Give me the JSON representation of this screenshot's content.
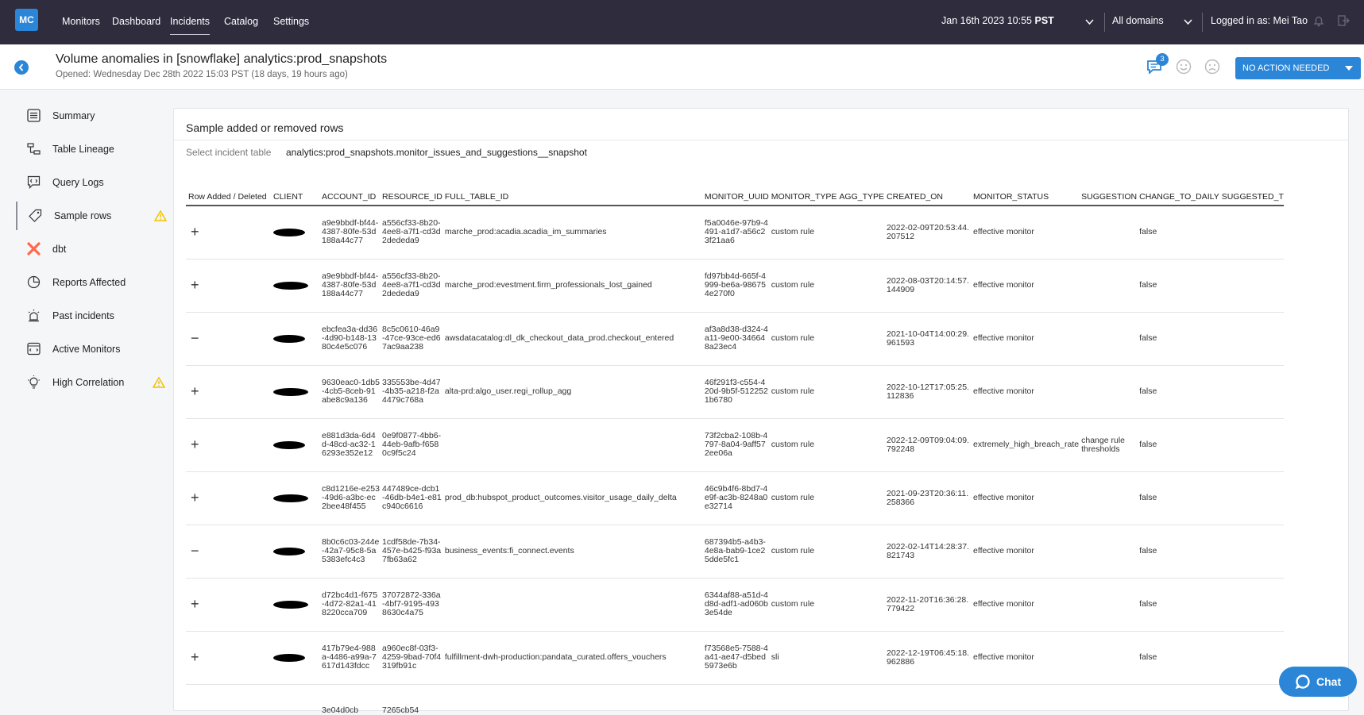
{
  "topbar": {
    "logo": "MC",
    "nav": [
      "Monitors",
      "Dashboard",
      "Incidents",
      "Catalog",
      "Settings"
    ],
    "active_nav": "Incidents",
    "datetime_main": "Jan 16th 2023 10:55",
    "datetime_tz": "PST",
    "domains": "All domains",
    "logged_in": "Logged in as: Mei Tao"
  },
  "header": {
    "title": "Volume anomalies in [snowflake] analytics:prod_snapshots",
    "subtitle": "Opened: Wednesday Dec 28th 2022 15:03 PST (18 days, 19 hours ago)",
    "comments_count": "3",
    "action_label": "NO ACTION NEEDED"
  },
  "sidebar": {
    "items": [
      {
        "label": "Summary",
        "icon": "list-icon"
      },
      {
        "label": "Table Lineage",
        "icon": "lineage-icon"
      },
      {
        "label": "Query Logs",
        "icon": "query-icon"
      },
      {
        "label": "Sample rows",
        "icon": "tag-icon",
        "active": true,
        "warning": true
      },
      {
        "label": "dbt",
        "icon": "dbt-icon"
      },
      {
        "label": "Reports Affected",
        "icon": "pie-icon"
      },
      {
        "label": "Past incidents",
        "icon": "alarm-icon"
      },
      {
        "label": "Active Monitors",
        "icon": "monitor-icon"
      },
      {
        "label": "High Correlation",
        "icon": "bulb-icon",
        "warning": true
      }
    ]
  },
  "panel": {
    "title": "Sample added or removed rows",
    "select_label": "Select incident table",
    "select_value": "analytics:prod_snapshots.monitor_issues_and_suggestions__snapshot"
  },
  "table": {
    "columns": [
      "Row Added / Deleted",
      "CLIENT",
      "ACCOUNT_ID",
      "RESOURCE_ID",
      "FULL_TABLE_ID",
      "MONITOR_UUID",
      "MONITOR_TYPE",
      "AGG_TYPE",
      "CREATED_ON",
      "MONITOR_STATUS",
      "SUGGESTION",
      "CHANGE_TO_DAILY",
      "SUGGESTED_T"
    ],
    "rows": [
      {
        "sign": "+",
        "account_id": "a9e9bbdf-bf44-4387-80fe-53d188a44c77",
        "resource_id": "a556cf33-8b20-4ee8-a7f1-cd3d2dededa9",
        "full_table_id": "marche_prod:acadia.acadia_im_summaries",
        "monitor_uuid": "f5a0046e-97b9-4491-a1d7-a56c23f21aa6",
        "monitor_type": "custom rule",
        "agg_type": "",
        "created_on": "2022-02-09T20:53:44.207512",
        "monitor_status": "effective monitor",
        "suggestion": "",
        "change_to_daily": "false",
        "suggested_t": ""
      },
      {
        "sign": "+",
        "account_id": "a9e9bbdf-bf44-4387-80fe-53d188a44c77",
        "resource_id": "a556cf33-8b20-4ee8-a7f1-cd3d2dededa9",
        "full_table_id": "marche_prod:evestment.firm_professionals_lost_gained",
        "monitor_uuid": "fd97bb4d-665f-4999-be6a-986754e270f0",
        "monitor_type": "custom rule",
        "agg_type": "",
        "created_on": "2022-08-03T20:14:57.144909",
        "monitor_status": "effective monitor",
        "suggestion": "",
        "change_to_daily": "false",
        "suggested_t": ""
      },
      {
        "sign": "−",
        "account_id": "ebcfea3a-dd36-4d90-b148-1380c4e5c076",
        "resource_id": "8c5c0610-46a9-47ce-93ce-ed67ac9aa238",
        "full_table_id": "awsdatacatalog:dl_dk_checkout_data_prod.checkout_entered",
        "monitor_uuid": "af3a8d38-d324-4a11-9e00-346648a23ec4",
        "monitor_type": "custom rule",
        "agg_type": "",
        "created_on": "2021-10-04T14:00:29.961593",
        "monitor_status": "effective monitor",
        "suggestion": "",
        "change_to_daily": "false",
        "suggested_t": ""
      },
      {
        "sign": "+",
        "account_id": "9630eac0-1db5-4cb5-8ceb-91abe8c9a136",
        "resource_id": "335553be-4d47-4b35-a218-f2a4479c768a",
        "full_table_id": "alta-prd:algo_user.regi_rollup_agg",
        "monitor_uuid": "46f291f3-c554-420d-9b5f-5122521b6780",
        "monitor_type": "custom rule",
        "agg_type": "",
        "created_on": "2022-10-12T17:05:25.112836",
        "monitor_status": "effective monitor",
        "suggestion": "",
        "change_to_daily": "false",
        "suggested_t": ""
      },
      {
        "sign": "+",
        "account_id": "e881d3da-6d4d-48cd-ac32-16293e352e12",
        "resource_id": "0e9f0877-4bb6-44eb-9afb-f6580c9f5c24",
        "full_table_id": "",
        "monitor_uuid": "73f2cba2-108b-4797-8a04-9aff572ee06a",
        "monitor_type": "custom rule",
        "agg_type": "",
        "created_on": "2022-12-09T09:04:09.792248",
        "monitor_status": "extremely_high_breach_rate",
        "suggestion": "change rule thresholds",
        "change_to_daily": "false",
        "suggested_t": ""
      },
      {
        "sign": "+",
        "account_id": "c8d1216e-e253-49d6-a3bc-ec2bee48f455",
        "resource_id": "447489ce-dcb1-46db-b4e1-e81c940c6616",
        "full_table_id": "prod_db:hubspot_product_outcomes.visitor_usage_daily_delta",
        "monitor_uuid": "46c9b4f6-8bd7-4e9f-ac3b-8248a0e32714",
        "monitor_type": "custom rule",
        "agg_type": "",
        "created_on": "2021-09-23T20:36:11.258366",
        "monitor_status": "effective monitor",
        "suggestion": "",
        "change_to_daily": "false",
        "suggested_t": ""
      },
      {
        "sign": "−",
        "account_id": "8b0c6c03-244e-42a7-95c8-5a5383efc4c3",
        "resource_id": "1cdf58de-7b34-457e-b425-f93a7fb63a62",
        "full_table_id": "business_events:fi_connect.events",
        "monitor_uuid": "687394b5-a4b3-4e8a-bab9-1ce25dde5fc1",
        "monitor_type": "custom rule",
        "agg_type": "",
        "created_on": "2022-02-14T14:28:37.821743",
        "monitor_status": "effective monitor",
        "suggestion": "",
        "change_to_daily": "false",
        "suggested_t": ""
      },
      {
        "sign": "+",
        "account_id": "d72bc4d1-f675-4d72-82a1-418220cca709",
        "resource_id": "37072872-336a-4bf7-9195-4938630c4a75",
        "full_table_id": "",
        "monitor_uuid": "6344af88-a51d-4d8d-adf1-ad060b3e54de",
        "monitor_type": "custom rule",
        "agg_type": "",
        "created_on": "2022-11-20T16:36:28.779422",
        "monitor_status": "effective monitor",
        "suggestion": "",
        "change_to_daily": "false",
        "suggested_t": ""
      },
      {
        "sign": "+",
        "account_id": "417b79e4-988a-4486-a99a-7617d143fdcc",
        "resource_id": "a960ec8f-03f3-4259-9bad-70f4319fb91c",
        "full_table_id": "fulfillment-dwh-production:pandata_curated.offers_vouchers",
        "monitor_uuid": "f73568e5-7588-4a41-ae47-d5bed5973e6b",
        "monitor_type": "sli",
        "agg_type": "",
        "created_on": "2022-12-19T06:45:18.962886",
        "monitor_status": "effective monitor",
        "suggestion": "",
        "change_to_daily": "false",
        "suggested_t": ""
      },
      {
        "sign": "",
        "account_id": "3e04d0cb",
        "resource_id": "7265cb54",
        "full_table_id": "",
        "monitor_uuid": "",
        "monitor_type": "",
        "agg_type": "",
        "created_on": "",
        "monitor_status": "",
        "suggestion": "",
        "change_to_daily": "",
        "suggested_t": ""
      }
    ]
  },
  "chat": {
    "label": "Chat"
  },
  "colors": {
    "topbar": "#2e2c3d",
    "accent": "#2b86d8",
    "warning": "#f2c200",
    "dbt": "#ff694b"
  }
}
